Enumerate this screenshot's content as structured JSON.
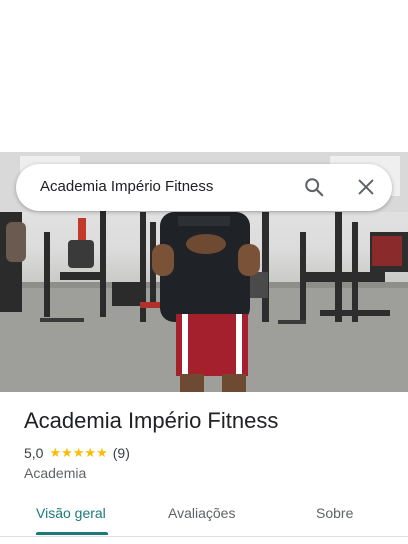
{
  "search": {
    "query": "Academia Império Fitness",
    "search_icon": "search-icon",
    "close_icon": "close-icon"
  },
  "hero": {
    "photo_icon": "gym-photo"
  },
  "place": {
    "name": "Academia Império Fitness",
    "rating": "5,0",
    "stars": "★★★★★",
    "review_count": "(9)",
    "category": "Academia"
  },
  "tabs": [
    {
      "label": "Visão geral",
      "active": true
    },
    {
      "label": "Avaliações",
      "active": false
    },
    {
      "label": "Sobre",
      "active": false
    }
  ],
  "colors": {
    "accent": "#1a7a7a",
    "star": "#fbbc04",
    "title": "#202124"
  }
}
